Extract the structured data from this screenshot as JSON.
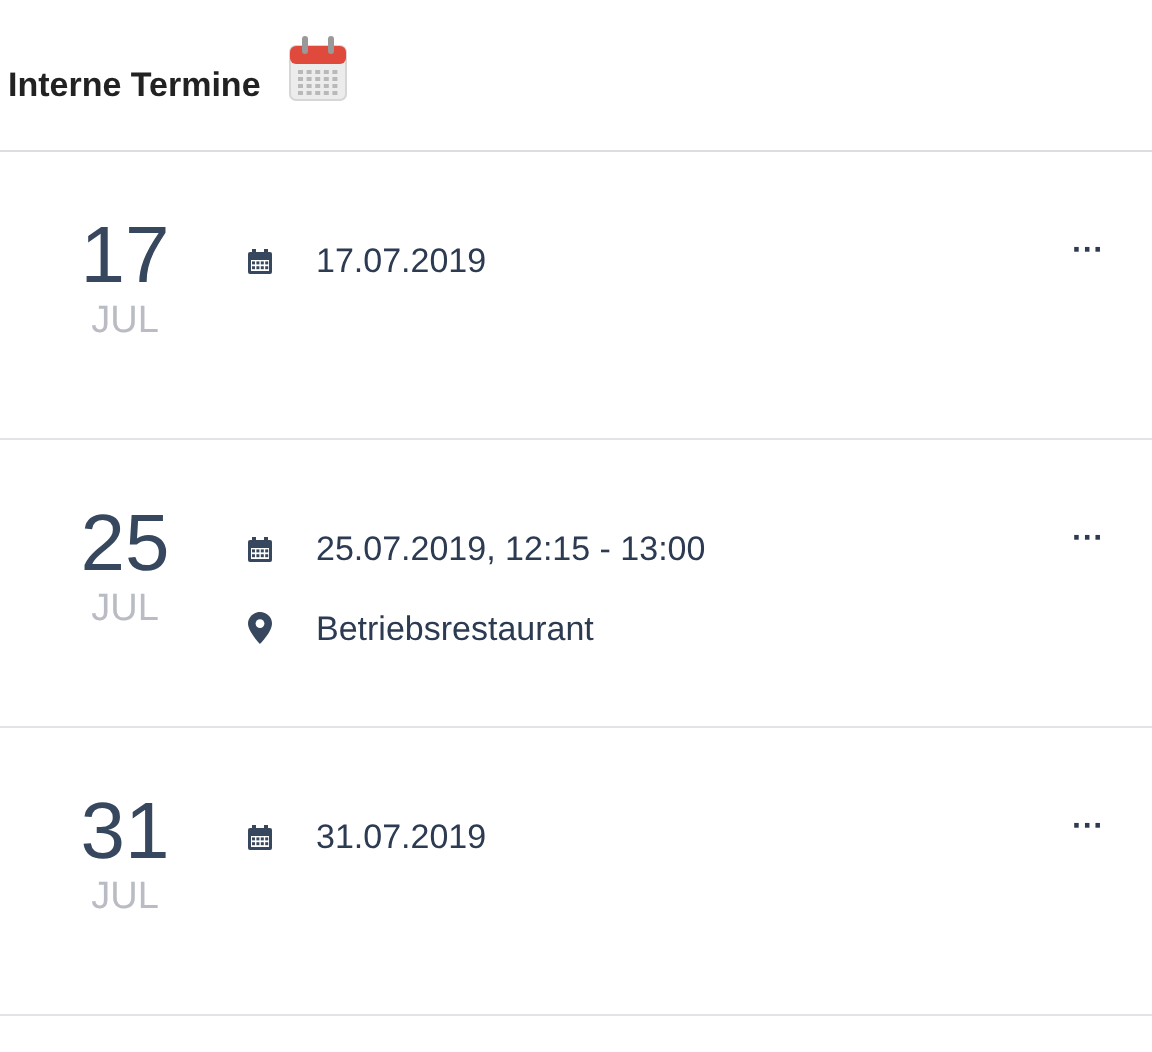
{
  "header": {
    "title": "Interne Termine"
  },
  "events": [
    {
      "day": "17",
      "month": "JUL",
      "date": "17.07.2019",
      "more": "···"
    },
    {
      "day": "25",
      "month": "JUL",
      "date": "25.07.2019, 12:15 - 13:00",
      "location": "Betriebsrestaurant",
      "more": "···"
    },
    {
      "day": "31",
      "month": "JUL",
      "date": "31.07.2019",
      "more": "···"
    }
  ]
}
